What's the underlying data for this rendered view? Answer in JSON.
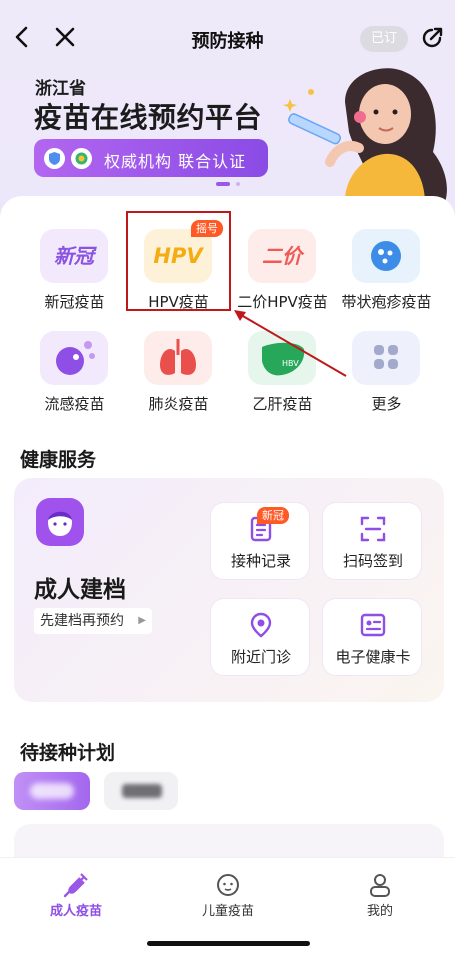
{
  "nav": {
    "title": "预防接种",
    "subscribed_label": "已订"
  },
  "banner": {
    "province": "浙江省",
    "headline": "疫苗在线预约平台",
    "badge_text": "权威机构  联合认证"
  },
  "vaccines": [
    {
      "label": "新冠疫苗",
      "icon_text": "新冠",
      "icon": "covid-icon"
    },
    {
      "label": "HPV疫苗",
      "icon_text": "HPV",
      "icon": "hpv-icon",
      "tag": "摇号"
    },
    {
      "label": "二价HPV疫苗",
      "icon_text": "二价",
      "icon": "bivalent-hpv-icon"
    },
    {
      "label": "带状疱疹疫苗",
      "icon": "shingles-icon"
    },
    {
      "label": "流感疫苗",
      "icon": "flu-icon"
    },
    {
      "label": "肺炎疫苗",
      "icon": "lungs-icon"
    },
    {
      "label": "乙肝疫苗",
      "icon_text": "HBV",
      "icon": "liver-icon"
    },
    {
      "label": "更多",
      "icon": "grid-more-icon"
    }
  ],
  "health": {
    "section_title": "健康服务",
    "adult_title": "成人建档",
    "adult_sub": "先建档再预约",
    "services": [
      {
        "label": "接种记录",
        "icon": "record-icon",
        "tag": "新冠"
      },
      {
        "label": "扫码签到",
        "icon": "scan-icon"
      },
      {
        "label": "附近门诊",
        "icon": "location-icon"
      },
      {
        "label": "电子健康卡",
        "icon": "health-card-icon"
      }
    ]
  },
  "plan": {
    "section_title": "待接种计划"
  },
  "tabs": [
    {
      "label": "成人疫苗",
      "icon": "syringe-icon",
      "active": true
    },
    {
      "label": "儿童疫苗",
      "icon": "child-face-icon"
    },
    {
      "label": "我的",
      "icon": "person-icon"
    }
  ],
  "colors": {
    "brand": "#9a57e8",
    "tag": "#ff5a26",
    "highlight": "#c0171b"
  }
}
